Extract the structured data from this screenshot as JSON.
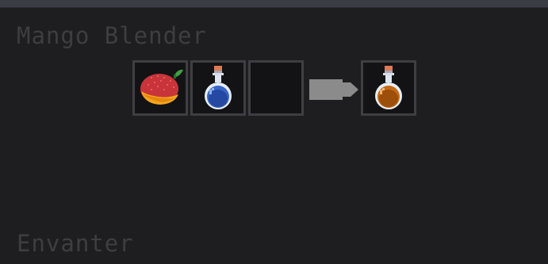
{
  "gui": {
    "title": "Mango Blender",
    "inventory_label": "Envanter"
  },
  "input_slots": [
    {
      "item": "mango-icon"
    },
    {
      "item": "water-bottle-icon"
    },
    {
      "item": ""
    }
  ],
  "output_slot": {
    "item": "mango-juice-bottle-icon"
  },
  "colors": {
    "background": "#1e1e21",
    "slot_fill": "#131316",
    "slot_border": "#3f3f43",
    "label_text": "#3e3e42",
    "arrow": "#8b8b8b"
  }
}
